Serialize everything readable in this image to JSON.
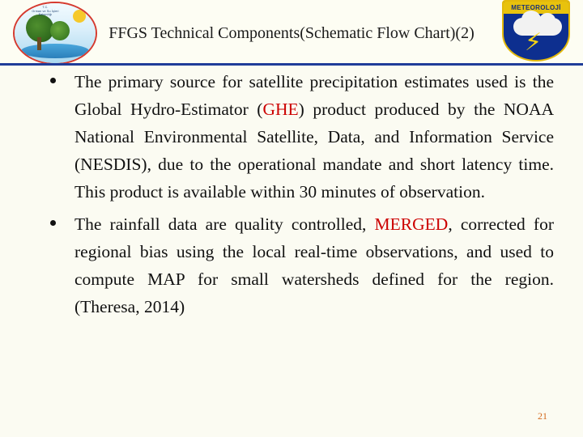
{
  "slide": {
    "title": "FFGS Technical Components(Schematic Flow Chart)(2)",
    "page_number": "21",
    "accent_color": "#cc0000",
    "header_rule_color": "#1f3c99",
    "background_color": "#fbfbf2"
  },
  "logos": {
    "left": {
      "icon": "nature-water-emblem-icon",
      "caption": "T.C.\nOrman ve Su İşleri\nBakanlığı"
    },
    "right": {
      "icon": "meteorology-shield-icon",
      "band_label": "METEOROLOJİ",
      "bolt": "⚡"
    }
  },
  "bullets": [
    {
      "id": "bullet-1",
      "segments": [
        {
          "text": "The primary source for satellite precipitation estimates used is the Global Hydro-Estimator (",
          "style": "normal"
        },
        {
          "text": "GHE",
          "style": "accent"
        },
        {
          "text": ") product produced by the NOAA National Environmental Satellite, Data, and Information Service (NESDIS), due to the operational mandate and short latency time. This product is available within 30 minutes of observation.",
          "style": "normal"
        }
      ]
    },
    {
      "id": "bullet-2",
      "segments": [
        {
          "text": "The rainfall data are quality controlled, ",
          "style": "normal"
        },
        {
          "text": "MERGED",
          "style": "accent"
        },
        {
          "text": ", corrected for regional bias using the local real-time observations, and used to compute MAP for small watersheds defined for the region. (Theresa, 2014)",
          "style": "normal"
        }
      ]
    }
  ]
}
